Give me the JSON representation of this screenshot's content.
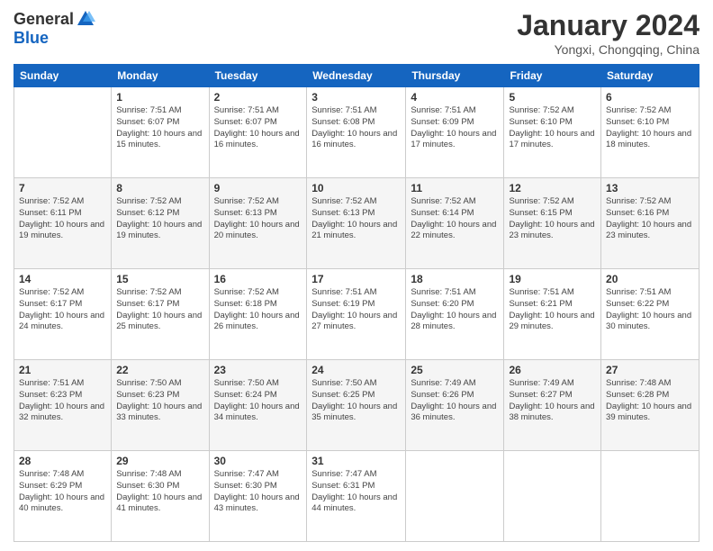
{
  "header": {
    "logo": {
      "general": "General",
      "blue": "Blue"
    },
    "title": "January 2024",
    "location": "Yongxi, Chongqing, China"
  },
  "calendar": {
    "headers": [
      "Sunday",
      "Monday",
      "Tuesday",
      "Wednesday",
      "Thursday",
      "Friday",
      "Saturday"
    ],
    "weeks": [
      [
        {
          "day": "",
          "sunrise": "",
          "sunset": "",
          "daylight": ""
        },
        {
          "day": "1",
          "sunrise": "Sunrise: 7:51 AM",
          "sunset": "Sunset: 6:07 PM",
          "daylight": "Daylight: 10 hours and 15 minutes."
        },
        {
          "day": "2",
          "sunrise": "Sunrise: 7:51 AM",
          "sunset": "Sunset: 6:07 PM",
          "daylight": "Daylight: 10 hours and 16 minutes."
        },
        {
          "day": "3",
          "sunrise": "Sunrise: 7:51 AM",
          "sunset": "Sunset: 6:08 PM",
          "daylight": "Daylight: 10 hours and 16 minutes."
        },
        {
          "day": "4",
          "sunrise": "Sunrise: 7:51 AM",
          "sunset": "Sunset: 6:09 PM",
          "daylight": "Daylight: 10 hours and 17 minutes."
        },
        {
          "day": "5",
          "sunrise": "Sunrise: 7:52 AM",
          "sunset": "Sunset: 6:10 PM",
          "daylight": "Daylight: 10 hours and 17 minutes."
        },
        {
          "day": "6",
          "sunrise": "Sunrise: 7:52 AM",
          "sunset": "Sunset: 6:10 PM",
          "daylight": "Daylight: 10 hours and 18 minutes."
        }
      ],
      [
        {
          "day": "7",
          "sunrise": "Sunrise: 7:52 AM",
          "sunset": "Sunset: 6:11 PM",
          "daylight": "Daylight: 10 hours and 19 minutes."
        },
        {
          "day": "8",
          "sunrise": "Sunrise: 7:52 AM",
          "sunset": "Sunset: 6:12 PM",
          "daylight": "Daylight: 10 hours and 19 minutes."
        },
        {
          "day": "9",
          "sunrise": "Sunrise: 7:52 AM",
          "sunset": "Sunset: 6:13 PM",
          "daylight": "Daylight: 10 hours and 20 minutes."
        },
        {
          "day": "10",
          "sunrise": "Sunrise: 7:52 AM",
          "sunset": "Sunset: 6:13 PM",
          "daylight": "Daylight: 10 hours and 21 minutes."
        },
        {
          "day": "11",
          "sunrise": "Sunrise: 7:52 AM",
          "sunset": "Sunset: 6:14 PM",
          "daylight": "Daylight: 10 hours and 22 minutes."
        },
        {
          "day": "12",
          "sunrise": "Sunrise: 7:52 AM",
          "sunset": "Sunset: 6:15 PM",
          "daylight": "Daylight: 10 hours and 23 minutes."
        },
        {
          "day": "13",
          "sunrise": "Sunrise: 7:52 AM",
          "sunset": "Sunset: 6:16 PM",
          "daylight": "Daylight: 10 hours and 23 minutes."
        }
      ],
      [
        {
          "day": "14",
          "sunrise": "Sunrise: 7:52 AM",
          "sunset": "Sunset: 6:17 PM",
          "daylight": "Daylight: 10 hours and 24 minutes."
        },
        {
          "day": "15",
          "sunrise": "Sunrise: 7:52 AM",
          "sunset": "Sunset: 6:17 PM",
          "daylight": "Daylight: 10 hours and 25 minutes."
        },
        {
          "day": "16",
          "sunrise": "Sunrise: 7:52 AM",
          "sunset": "Sunset: 6:18 PM",
          "daylight": "Daylight: 10 hours and 26 minutes."
        },
        {
          "day": "17",
          "sunrise": "Sunrise: 7:51 AM",
          "sunset": "Sunset: 6:19 PM",
          "daylight": "Daylight: 10 hours and 27 minutes."
        },
        {
          "day": "18",
          "sunrise": "Sunrise: 7:51 AM",
          "sunset": "Sunset: 6:20 PM",
          "daylight": "Daylight: 10 hours and 28 minutes."
        },
        {
          "day": "19",
          "sunrise": "Sunrise: 7:51 AM",
          "sunset": "Sunset: 6:21 PM",
          "daylight": "Daylight: 10 hours and 29 minutes."
        },
        {
          "day": "20",
          "sunrise": "Sunrise: 7:51 AM",
          "sunset": "Sunset: 6:22 PM",
          "daylight": "Daylight: 10 hours and 30 minutes."
        }
      ],
      [
        {
          "day": "21",
          "sunrise": "Sunrise: 7:51 AM",
          "sunset": "Sunset: 6:23 PM",
          "daylight": "Daylight: 10 hours and 32 minutes."
        },
        {
          "day": "22",
          "sunrise": "Sunrise: 7:50 AM",
          "sunset": "Sunset: 6:23 PM",
          "daylight": "Daylight: 10 hours and 33 minutes."
        },
        {
          "day": "23",
          "sunrise": "Sunrise: 7:50 AM",
          "sunset": "Sunset: 6:24 PM",
          "daylight": "Daylight: 10 hours and 34 minutes."
        },
        {
          "day": "24",
          "sunrise": "Sunrise: 7:50 AM",
          "sunset": "Sunset: 6:25 PM",
          "daylight": "Daylight: 10 hours and 35 minutes."
        },
        {
          "day": "25",
          "sunrise": "Sunrise: 7:49 AM",
          "sunset": "Sunset: 6:26 PM",
          "daylight": "Daylight: 10 hours and 36 minutes."
        },
        {
          "day": "26",
          "sunrise": "Sunrise: 7:49 AM",
          "sunset": "Sunset: 6:27 PM",
          "daylight": "Daylight: 10 hours and 38 minutes."
        },
        {
          "day": "27",
          "sunrise": "Sunrise: 7:48 AM",
          "sunset": "Sunset: 6:28 PM",
          "daylight": "Daylight: 10 hours and 39 minutes."
        }
      ],
      [
        {
          "day": "28",
          "sunrise": "Sunrise: 7:48 AM",
          "sunset": "Sunset: 6:29 PM",
          "daylight": "Daylight: 10 hours and 40 minutes."
        },
        {
          "day": "29",
          "sunrise": "Sunrise: 7:48 AM",
          "sunset": "Sunset: 6:30 PM",
          "daylight": "Daylight: 10 hours and 41 minutes."
        },
        {
          "day": "30",
          "sunrise": "Sunrise: 7:47 AM",
          "sunset": "Sunset: 6:30 PM",
          "daylight": "Daylight: 10 hours and 43 minutes."
        },
        {
          "day": "31",
          "sunrise": "Sunrise: 7:47 AM",
          "sunset": "Sunset: 6:31 PM",
          "daylight": "Daylight: 10 hours and 44 minutes."
        },
        {
          "day": "",
          "sunrise": "",
          "sunset": "",
          "daylight": ""
        },
        {
          "day": "",
          "sunrise": "",
          "sunset": "",
          "daylight": ""
        },
        {
          "day": "",
          "sunrise": "",
          "sunset": "",
          "daylight": ""
        }
      ]
    ]
  }
}
